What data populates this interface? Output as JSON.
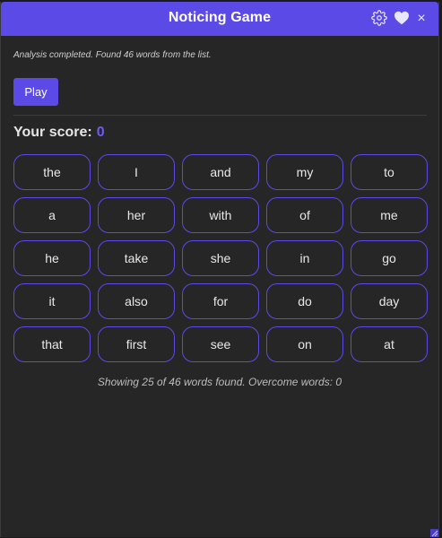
{
  "window": {
    "title": "Noticing Game",
    "close_glyph": "×"
  },
  "status": {
    "message": "Analysis completed. Found 46 words from the list."
  },
  "controls": {
    "play_label": "Play"
  },
  "score": {
    "label": "Your score:",
    "value": "0"
  },
  "words": [
    "the",
    "I",
    "and",
    "my",
    "to",
    "a",
    "her",
    "with",
    "of",
    "me",
    "he",
    "take",
    "she",
    "in",
    "go",
    "it",
    "also",
    "for",
    "do",
    "day",
    "that",
    "first",
    "see",
    "on",
    "at"
  ],
  "footer": {
    "summary": "Showing 25 of 46 words found. Overcome words: 0"
  },
  "icons": {
    "settings": "gear-icon",
    "favorite": "heart-icon",
    "close": "close-icon"
  },
  "colors": {
    "accent": "#5b4ae6",
    "score_value": "#6b5cf0",
    "background": "#262626"
  }
}
